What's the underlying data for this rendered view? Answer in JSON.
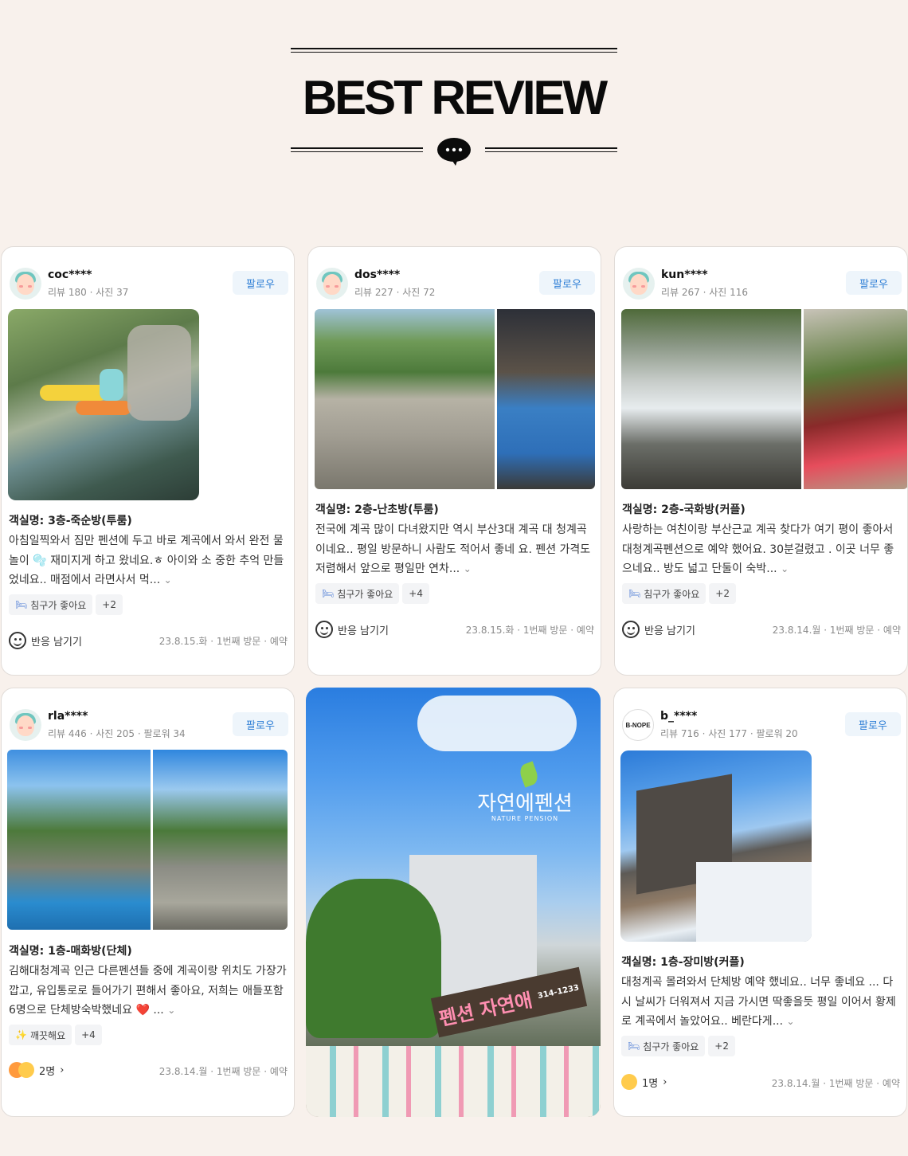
{
  "header": {
    "title": "BEST REVIEW"
  },
  "colors": {
    "background": "#f8f1ec",
    "follow_text": "#2f7fd6",
    "follow_bg": "#eef5fb"
  },
  "reviews": [
    {
      "user": "coc****",
      "stats": "리뷰 180 · 사진 37",
      "follow": "팔로우",
      "room": "객실명: 3층-죽순방(투룸)",
      "body": "아침일찍와서 짐만 펜션에 두고 바로 계곡에서 와서 완전 물놀이 🫧 재미지게 하고 왔네요.ㅎ 아이와 소 중한 추억 만들었네요.. 매점에서 라면사서 먹...",
      "tags": [
        "침구가 좋아요",
        "+2"
      ],
      "reaction": "반응 남기기",
      "meta": "23.8.15.화 · 1번째 방문 · 예약"
    },
    {
      "user": "dos****",
      "stats": "리뷰 227 · 사진 72",
      "follow": "팔로우",
      "room": "객실명: 2층-난초방(투룸)",
      "body": "전국에 계곡 많이 다녀왔지만 역시 부산3대 계곡 대 청계곡이네요.. 평일 방문하니 사람도 적어서 좋네 요. 펜션 가격도 저렴해서 앞으로 평일만 연차...",
      "tags": [
        "침구가 좋아요",
        "+4"
      ],
      "reaction": "반응 남기기",
      "meta": "23.8.15.화 · 1번째 방문 · 예약"
    },
    {
      "user": "kun****",
      "stats": "리뷰 267 · 사진 116",
      "follow": "팔로우",
      "room": "객실명: 2층-국화방(커플)",
      "body": "사랑하는 여친이랑 부산근교 계곡 찾다가 여기 평이 좋아서 대청계곡펜션으로 예약 했어요. 30분걸렸고 . 이곳 너무 좋으네요.. 방도 넓고 단둘이 숙박...",
      "tags": [
        "침구가 좋아요",
        "+2"
      ],
      "reaction": "반응 남기기",
      "meta": "23.8.14.월 · 1번째 방문 · 예약"
    },
    {
      "user": "rla****",
      "stats": "리뷰 446 · 사진 205 · 팔로워 34",
      "follow": "팔로우",
      "room": "객실명: 1층-매화방(단체)",
      "body": "김해대청계곡 인근 다른펜션들 중에 계곡이랑 위치도 가장가깝고, 유입통로로 들어가기 편해서 좋아요, 저희는 애들포함 6명으로 단체방숙박했네요 ❤️ ...",
      "tags": [
        "깨끗해요",
        "+4"
      ],
      "reaction": "2명",
      "meta": "23.8.14.월 · 1번째 방문 · 예약"
    },
    {
      "user": "b_****",
      "stats": "리뷰 716 · 사진 177 · 팔로워 20",
      "follow": "팔로우",
      "avatar_text": "B-NOPE",
      "room": "객실명: 1층-장미방(커플)",
      "body": "대청계곡 몰려와서 단체방 예약 했네요.. 너무 좋네요 ... 다시 날씨가 더워져서 지금 가시면 딱좋을듯 평일 이어서 황제로 계곡에서 놀았어요.. 베란다게...",
      "tags": [
        "침구가 좋아요",
        "+2"
      ],
      "reaction": "1명",
      "meta": "23.8.14.월 · 1번째 방문 · 예약"
    }
  ],
  "promo": {
    "brand_ko": "자연에펜션",
    "brand_en": "NATURE PENSION",
    "sign_text": "펜션 자연애",
    "sign_phone": "314-1233"
  }
}
